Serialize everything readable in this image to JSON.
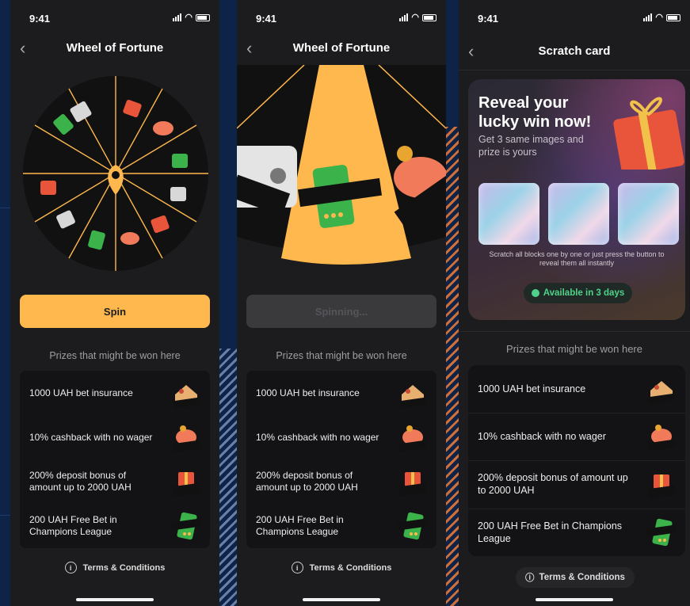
{
  "status": {
    "time": "9:41"
  },
  "screens": [
    {
      "title": "Wheel of Fortune",
      "button_label": "Spin",
      "prizes_heading": "Prizes that might be won here",
      "terms_label": "Terms & Conditions"
    },
    {
      "title": "Wheel of Fortune",
      "button_label": "Spinning...",
      "prizes_heading": "Prizes that might be won here",
      "terms_label": "Terms & Conditions",
      "visible_segment_labels": [
        "INSU\nRANCE",
        "FREE BET",
        "CASHBACK BONUS"
      ]
    },
    {
      "title": "Scratch card",
      "headline": "Reveal your lucky win now!",
      "subtitle": "Get 3 same images and prize is yours",
      "hint": "Scratch all blocks one by one or just press the button to reveal them all instantly",
      "availability": "Available in 3 days",
      "prizes_heading": "Prizes that might be won here",
      "terms_label": "Terms & Conditions"
    }
  ],
  "prizes": [
    {
      "text": "1000 UAH bet insurance",
      "icon": "insurance-icon",
      "icon_label": "INSU RANCE"
    },
    {
      "text": "10% cashback with no wager",
      "icon": "cashback-bonus-icon",
      "icon_label": "CASHBACK BONUS"
    },
    {
      "text": "200% deposit bonus of amount up to 2000 UAH",
      "icon": "deposit-bonus-icon",
      "icon_label": "DEPOSIT BONUS"
    },
    {
      "text": "200 UAH Free Bet in Champions League",
      "icon": "free-bet-icon",
      "icon_label": "FREE BET"
    }
  ],
  "colors": {
    "accent": "#ffb84d",
    "background": "#1c1c1e",
    "list_bg": "#131315",
    "available_green": "#4fd28a",
    "wheel_line": "#ffb84d"
  }
}
